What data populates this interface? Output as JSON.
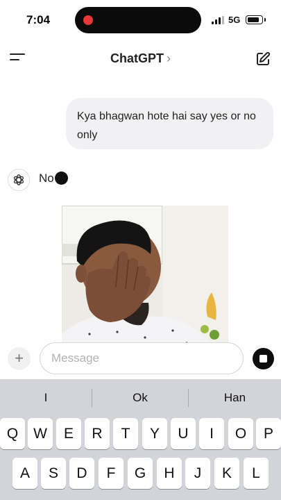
{
  "status_bar": {
    "time": "7:04",
    "network": "5G",
    "recording_color": "#e53935"
  },
  "header": {
    "title": "ChatGPT",
    "chevron": "›",
    "menu_icon": "menu-icon",
    "new_chat_icon": "new-chat-icon"
  },
  "conversation": {
    "user_message": "Kya bhagwan hote hai say yes or no only",
    "assistant_message": "No",
    "assistant_icon": "openai-logo-icon"
  },
  "overlay": {
    "description_icon": "facepalm-photo"
  },
  "composer": {
    "plus_label": "+",
    "input_value": "",
    "input_placeholder": "Message"
  },
  "keyboard": {
    "suggestions": [
      "I",
      "Ok",
      "Han"
    ],
    "row1": [
      "Q",
      "W",
      "E",
      "R",
      "T",
      "Y",
      "U",
      "I",
      "O",
      "P"
    ],
    "row2": [
      "A",
      "S",
      "D",
      "F",
      "G",
      "H",
      "J",
      "K",
      "L"
    ]
  }
}
